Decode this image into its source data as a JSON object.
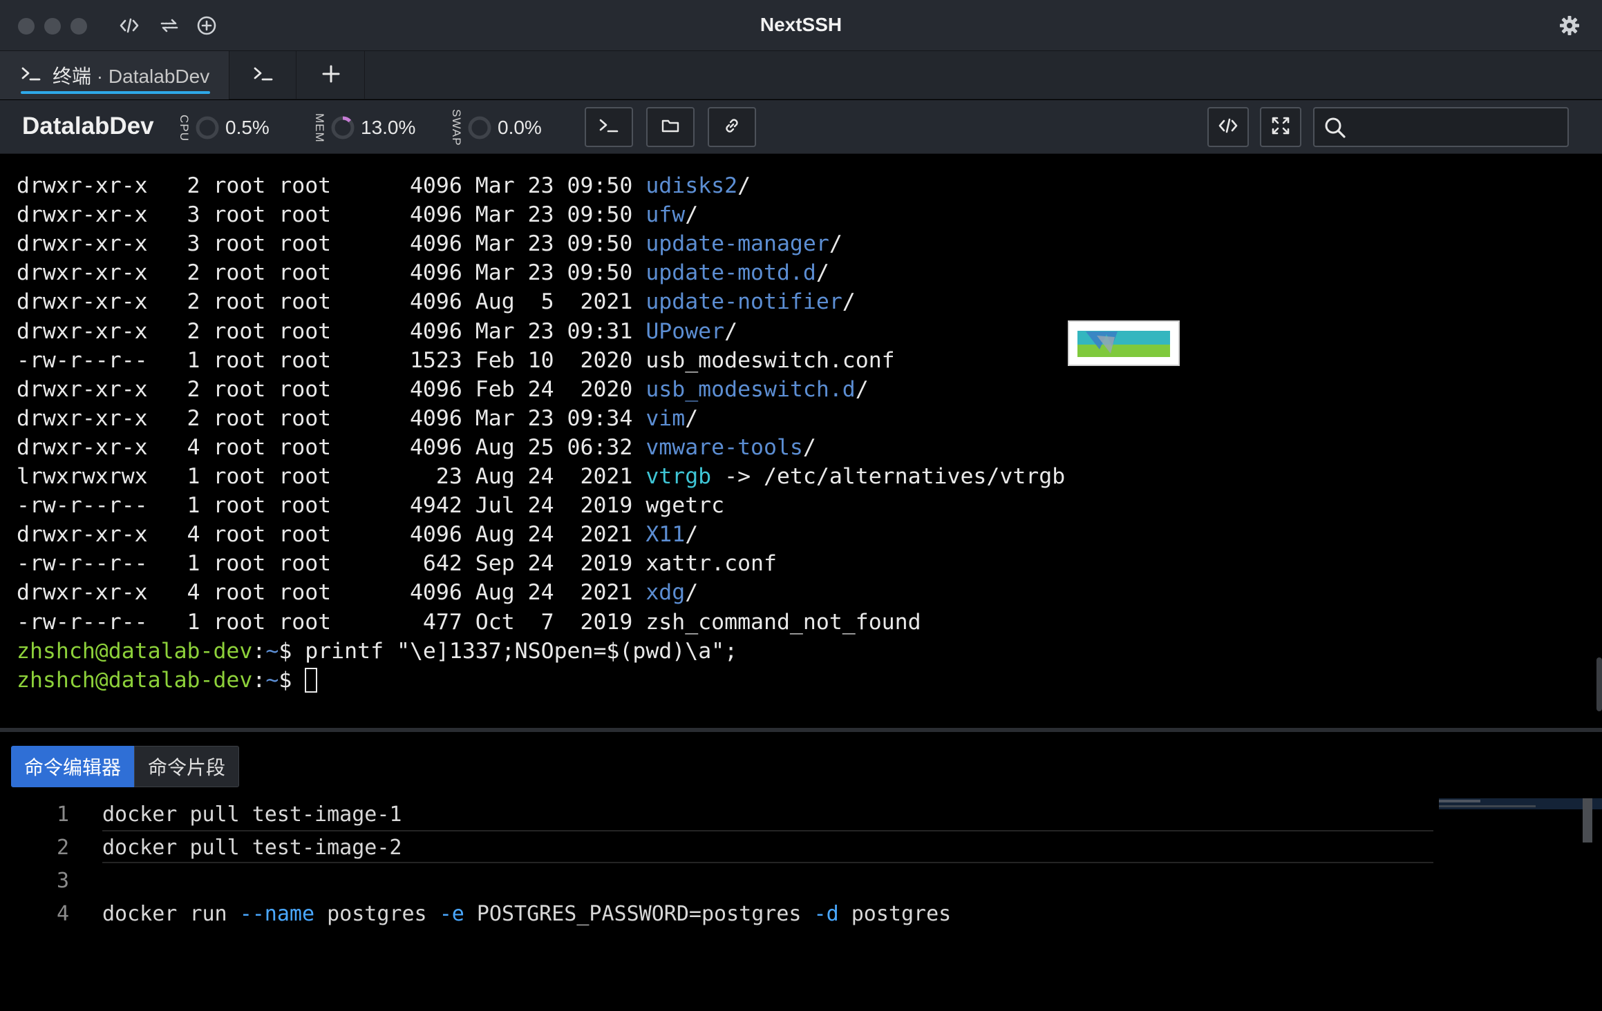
{
  "window": {
    "title": "NextSSH"
  },
  "tabs": [
    {
      "prefix": "终端",
      "separator": " · ",
      "label": "DatalabDev",
      "active": true
    },
    {
      "label": "",
      "active": false
    }
  ],
  "session": {
    "host": "DatalabDev",
    "meters": [
      {
        "name": "CPU",
        "value": "0.5%",
        "fraction": 0.005
      },
      {
        "name": "MEM",
        "value": "13.0%",
        "fraction": 0.13
      },
      {
        "name": "SWAP",
        "value": "0.0%",
        "fraction": 0.0
      }
    ],
    "search": {
      "placeholder": "",
      "value": ""
    }
  },
  "terminal": {
    "listing": [
      {
        "perm": "drwxr-xr-x",
        "links": "2",
        "owner": "root",
        "group": "root",
        "size": "4096",
        "mon": "Mar",
        "day": "23",
        "time": "09:50",
        "name": "udisks2",
        "suffix": "/",
        "type": "dir"
      },
      {
        "perm": "drwxr-xr-x",
        "links": "3",
        "owner": "root",
        "group": "root",
        "size": "4096",
        "mon": "Mar",
        "day": "23",
        "time": "09:50",
        "name": "ufw",
        "suffix": "/",
        "type": "dir"
      },
      {
        "perm": "drwxr-xr-x",
        "links": "3",
        "owner": "root",
        "group": "root",
        "size": "4096",
        "mon": "Mar",
        "day": "23",
        "time": "09:50",
        "name": "update-manager",
        "suffix": "/",
        "type": "dir"
      },
      {
        "perm": "drwxr-xr-x",
        "links": "2",
        "owner": "root",
        "group": "root",
        "size": "4096",
        "mon": "Mar",
        "day": "23",
        "time": "09:50",
        "name": "update-motd.d",
        "suffix": "/",
        "type": "dir"
      },
      {
        "perm": "drwxr-xr-x",
        "links": "2",
        "owner": "root",
        "group": "root",
        "size": "4096",
        "mon": "Aug",
        "day": "5",
        "time": "2021",
        "name": "update-notifier",
        "suffix": "/",
        "type": "dir"
      },
      {
        "perm": "drwxr-xr-x",
        "links": "2",
        "owner": "root",
        "group": "root",
        "size": "4096",
        "mon": "Mar",
        "day": "23",
        "time": "09:31",
        "name": "UPower",
        "suffix": "/",
        "type": "dir"
      },
      {
        "perm": "-rw-r--r--",
        "links": "1",
        "owner": "root",
        "group": "root",
        "size": "1523",
        "mon": "Feb",
        "day": "10",
        "time": "2020",
        "name": "usb_modeswitch.conf",
        "suffix": "",
        "type": "file"
      },
      {
        "perm": "drwxr-xr-x",
        "links": "2",
        "owner": "root",
        "group": "root",
        "size": "4096",
        "mon": "Feb",
        "day": "24",
        "time": "2020",
        "name": "usb_modeswitch.d",
        "suffix": "/",
        "type": "dir"
      },
      {
        "perm": "drwxr-xr-x",
        "links": "2",
        "owner": "root",
        "group": "root",
        "size": "4096",
        "mon": "Mar",
        "day": "23",
        "time": "09:34",
        "name": "vim",
        "suffix": "/",
        "type": "dir"
      },
      {
        "perm": "drwxr-xr-x",
        "links": "4",
        "owner": "root",
        "group": "root",
        "size": "4096",
        "mon": "Aug",
        "day": "25",
        "time": "06:32",
        "name": "vmware-tools",
        "suffix": "/",
        "type": "dir"
      },
      {
        "perm": "lrwxrwxrwx",
        "links": "1",
        "owner": "root",
        "group": "root",
        "size": "23",
        "mon": "Aug",
        "day": "24",
        "time": "2021",
        "name": "vtrgb",
        "suffix": " -> /etc/alternatives/vtrgb",
        "type": "link"
      },
      {
        "perm": "-rw-r--r--",
        "links": "1",
        "owner": "root",
        "group": "root",
        "size": "4942",
        "mon": "Jul",
        "day": "24",
        "time": "2019",
        "name": "wgetrc",
        "suffix": "",
        "type": "file"
      },
      {
        "perm": "drwxr-xr-x",
        "links": "4",
        "owner": "root",
        "group": "root",
        "size": "4096",
        "mon": "Aug",
        "day": "24",
        "time": "2021",
        "name": "X11",
        "suffix": "/",
        "type": "dir"
      },
      {
        "perm": "-rw-r--r--",
        "links": "1",
        "owner": "root",
        "group": "root",
        "size": "642",
        "mon": "Sep",
        "day": "24",
        "time": "2019",
        "name": "xattr.conf",
        "suffix": "",
        "type": "file"
      },
      {
        "perm": "drwxr-xr-x",
        "links": "4",
        "owner": "root",
        "group": "root",
        "size": "4096",
        "mon": "Aug",
        "day": "24",
        "time": "2021",
        "name": "xdg",
        "suffix": "/",
        "type": "dir"
      },
      {
        "perm": "-rw-r--r--",
        "links": "1",
        "owner": "root",
        "group": "root",
        "size": "477",
        "mon": "Oct",
        "day": "7",
        "time": "2019",
        "name": "zsh_command_not_found",
        "suffix": "",
        "type": "file"
      }
    ],
    "prompt_user": "zhshch@datalab-dev",
    "prompt_sep": ":",
    "prompt_path": "~",
    "prompt_sym": "$ ",
    "commands": [
      "printf \"\\e]1337;NSOpen=$(pwd)\\a\";",
      ""
    ]
  },
  "panel": {
    "tabs": [
      "命令编辑器",
      "命令片段"
    ],
    "active_tab": 0,
    "editor_lines": [
      {
        "num": "1",
        "text": "docker pull test-image-1"
      },
      {
        "num": "2",
        "text": "docker pull test-image-2"
      },
      {
        "num": "3",
        "text": ""
      },
      {
        "num": "4",
        "text": "docker run --name postgres -e POSTGRES_PASSWORD=postgres -d postgres"
      }
    ]
  },
  "colors": {
    "accent_tab_underline": "#2ea8e8",
    "dir": "#5c8ed3",
    "symlink": "#3fc6d6",
    "prompt": "#8dd13a",
    "active_panel_tab": "#2f6fd6"
  },
  "icons": [
    "code-icon",
    "transfer-icon",
    "add-circle-icon",
    "gear-icon",
    "terminal-icon",
    "plus-icon",
    "folder-icon",
    "link-icon",
    "fullscreen-icon",
    "search-icon"
  ]
}
